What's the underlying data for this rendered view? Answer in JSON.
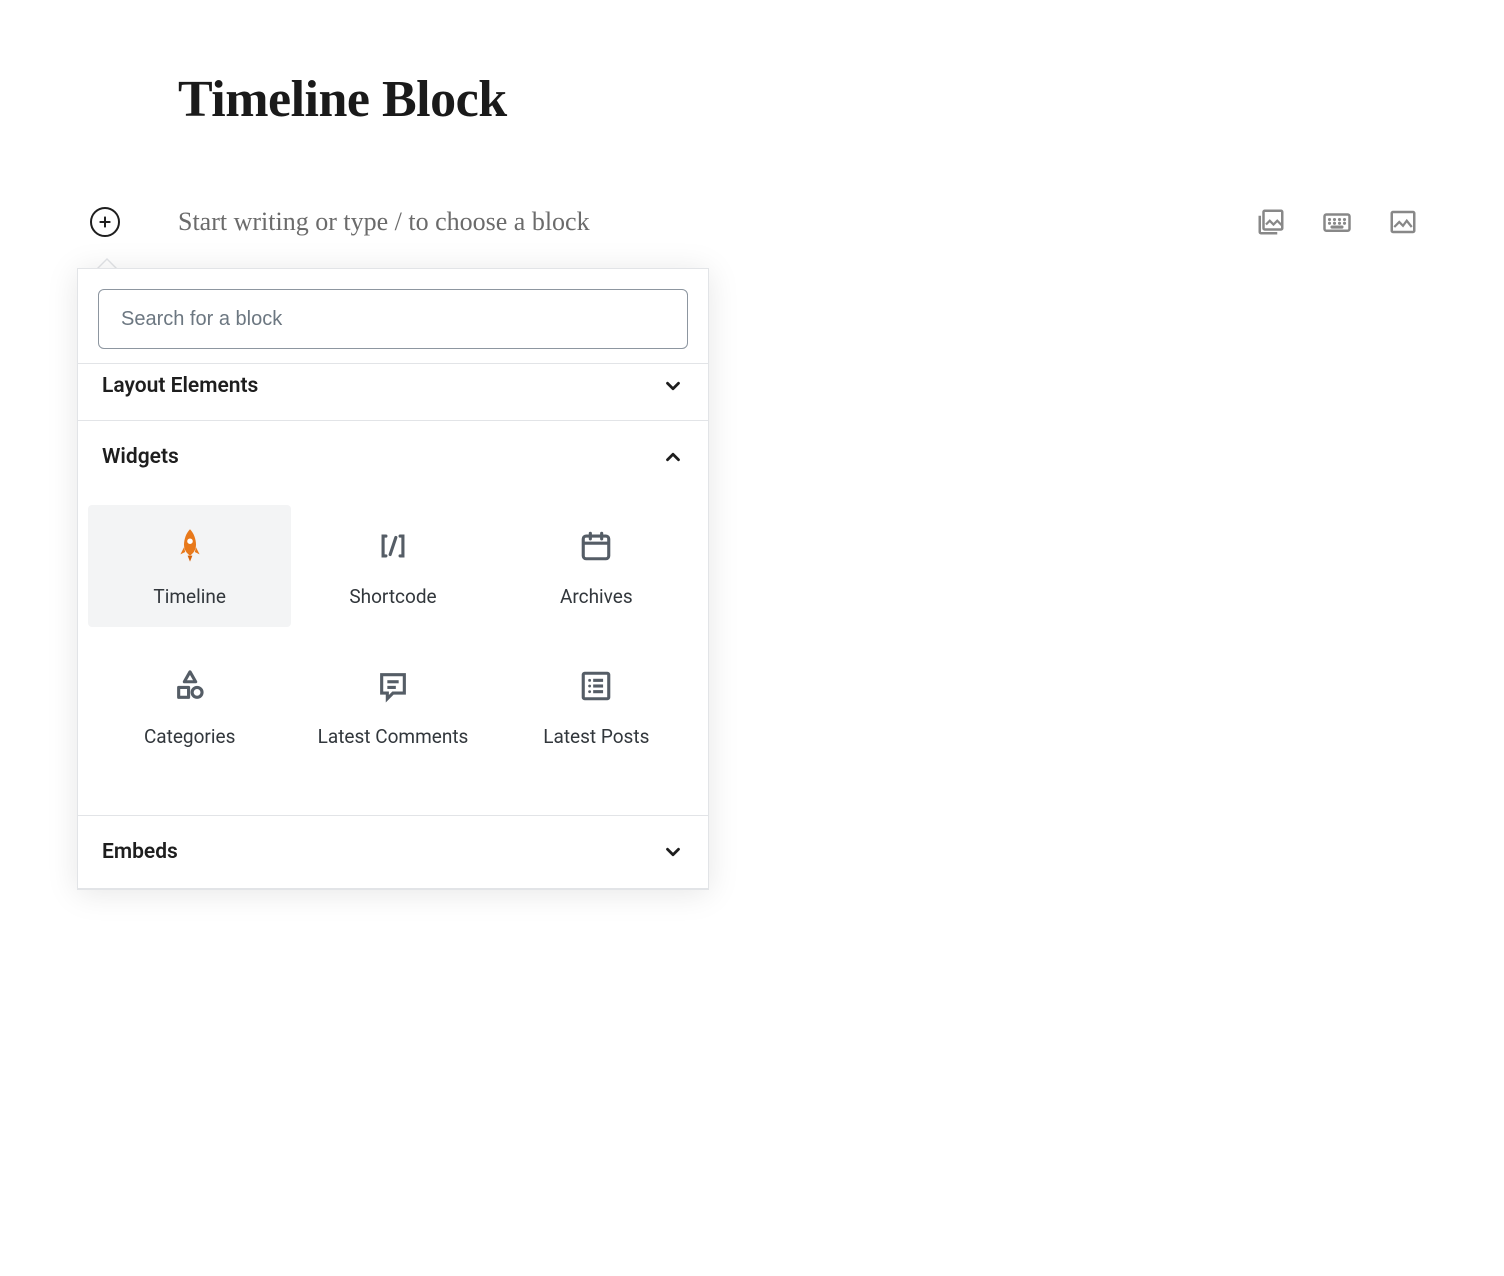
{
  "page": {
    "title": "Timeline Block"
  },
  "editor": {
    "placeholder": "Start writing or type / to choose a block"
  },
  "toolbar": {
    "gallery_icon": "gallery",
    "keyboard_icon": "keyboard",
    "image_icon": "image"
  },
  "inserter": {
    "search_placeholder": "Search for a block",
    "categories": [
      {
        "key": "layout",
        "label": "Layout Elements",
        "expanded": false
      },
      {
        "key": "widgets",
        "label": "Widgets",
        "expanded": true
      },
      {
        "key": "embeds",
        "label": "Embeds",
        "expanded": false
      }
    ],
    "widgets": [
      {
        "name": "Timeline",
        "icon": "rocket",
        "highlighted": true
      },
      {
        "name": "Shortcode",
        "icon": "shortcode",
        "highlighted": false
      },
      {
        "name": "Archives",
        "icon": "calendar",
        "highlighted": false
      },
      {
        "name": "Categories",
        "icon": "shapes",
        "highlighted": false
      },
      {
        "name": "Latest Comments",
        "icon": "comment",
        "highlighted": false
      },
      {
        "name": "Latest Posts",
        "icon": "list",
        "highlighted": false
      }
    ]
  }
}
